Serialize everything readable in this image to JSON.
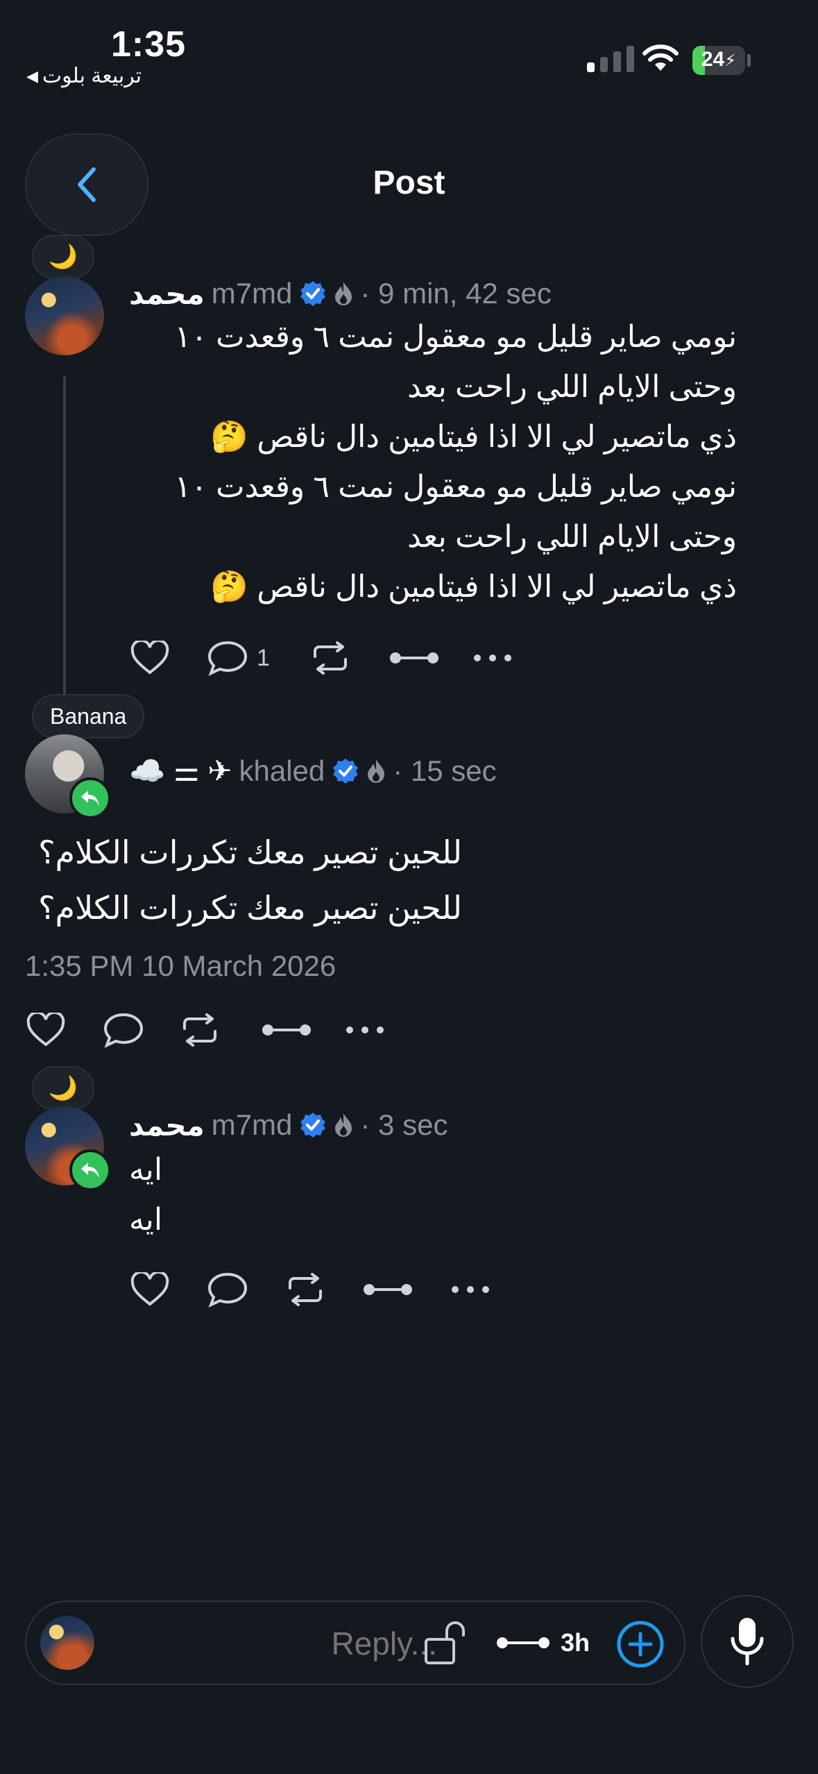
{
  "status_bar": {
    "time": "1:35",
    "back_app": "تربيعة بلوت",
    "battery": "24",
    "battery_level": 0.24
  },
  "header": {
    "title": "Post"
  },
  "posts": [
    {
      "mood": "🌙",
      "name": "محمد",
      "handle": "m7md",
      "time": "· 9 min, 42 sec",
      "lines": [
        "نومي صاير قليل مو معقول نمت ٦ وقعدت ١٠",
        "وحتى الايام اللي راحت بعد",
        "ذي ماتصير لي الا اذا فيتامين دال ناقص 🤔",
        "نومي صاير قليل مو معقول نمت ٦ وقعدت ١٠",
        "وحتى الايام اللي راحت بعد",
        "ذي ماتصير لي الا اذا فيتامين دال ناقص 🤔"
      ],
      "reply_count": "1"
    },
    {
      "mood": "Banana",
      "name_prefix": "☁️ ⚌ ✈",
      "handle": "khaled",
      "time": "· 15 sec",
      "lines": [
        "للحين تصير معك تكررات الكلام؟",
        "للحين تصير معك تكررات الكلام؟"
      ],
      "timestamp": "1:35 PM 10 March 2026"
    },
    {
      "mood": "🌙",
      "name": "محمد",
      "handle": "m7md",
      "time": "· 3 sec",
      "lines": [
        "ايه",
        "ايه"
      ]
    }
  ],
  "composer": {
    "placeholder": "Reply...",
    "duration": "3h"
  },
  "colors": {
    "background": "#14181f",
    "accent": "#1d9bf0",
    "verified": "#2f80ed",
    "reply_badge": "#32c15a",
    "muted_text": "#8b919b"
  }
}
